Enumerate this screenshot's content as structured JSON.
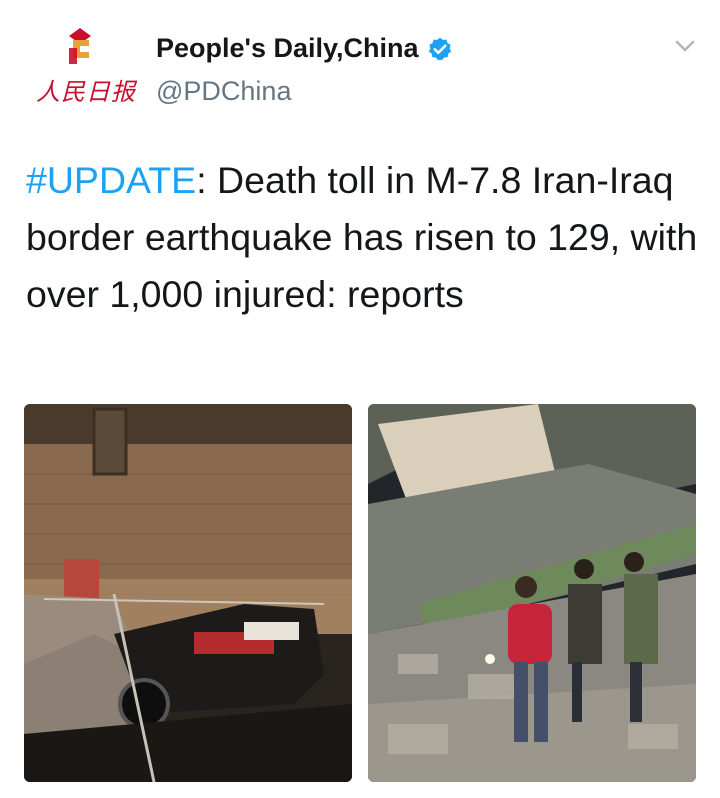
{
  "header": {
    "display_name": "People's Daily,China",
    "handle": "@PDChina",
    "logo_text": "人民日报",
    "verified_icon": "verified-badge-icon",
    "menu_icon": "chevron-down-icon"
  },
  "tweet": {
    "hashtag": "#UPDATE",
    "text": ": Death toll in M-7.8 Iran-Iraq border earthquake has risen to 129, with over 1,000 injured: reports"
  },
  "media": {
    "count": 2
  },
  "colors": {
    "link": "#1da1f2",
    "text": "#14171a",
    "muted": "#657786",
    "brand_red": "#c8102e"
  }
}
